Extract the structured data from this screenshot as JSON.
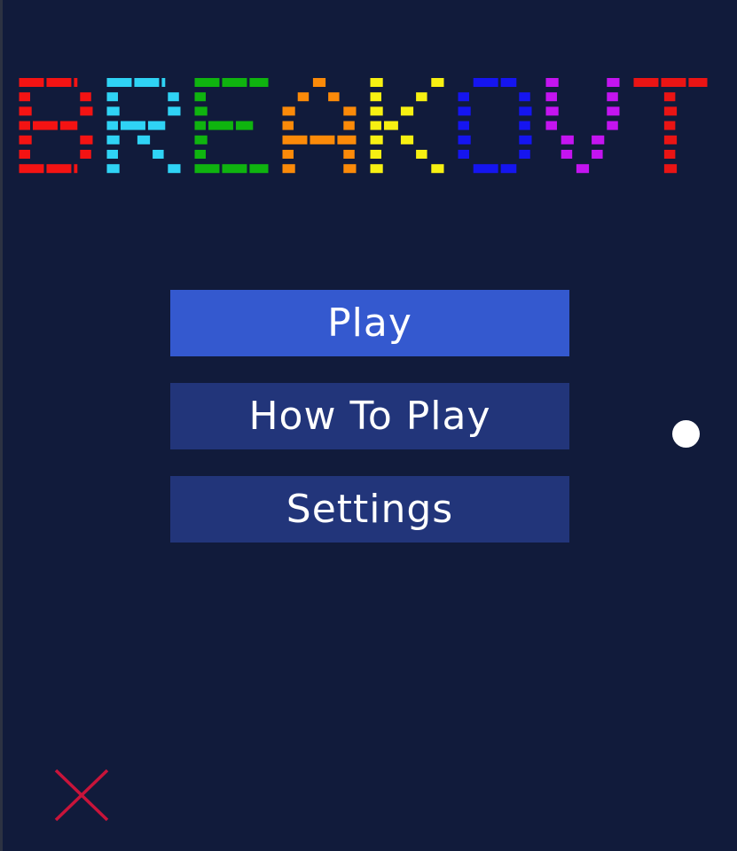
{
  "title": {
    "text": "BREAKOVT",
    "letters": [
      {
        "char": "B",
        "color": "#f41313"
      },
      {
        "char": "R",
        "color": "#2fd3f5"
      },
      {
        "char": "E",
        "color": "#0fb40f"
      },
      {
        "char": "A",
        "color": "#fb8a09"
      },
      {
        "char": "K",
        "color": "#f7f012"
      },
      {
        "char": "O",
        "color": "#1515f0"
      },
      {
        "char": "V",
        "color": "#c414f0"
      },
      {
        "char": "T",
        "color": "#ea1414"
      }
    ]
  },
  "menu": {
    "play_label": "Play",
    "howto_label": "How To Play",
    "settings_label": "Settings",
    "selected": "Play",
    "selected_color": "#3459cf",
    "normal_color": "#22357a"
  },
  "ball": {
    "icon": "ball",
    "color": "#ffffff"
  },
  "close": {
    "icon": "close-x-icon",
    "color": "#c8143a"
  }
}
